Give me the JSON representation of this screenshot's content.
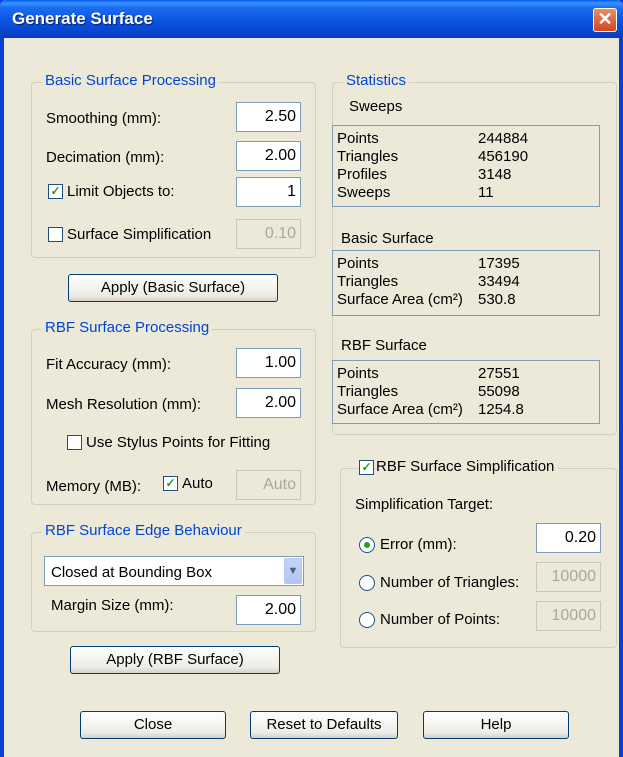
{
  "window": {
    "title": "Generate Surface",
    "close_glyph": "✕"
  },
  "basic": {
    "legend": "Basic Surface Processing",
    "smoothing_label": "Smoothing (mm):",
    "smoothing_value": "2.50",
    "decimation_label": "Decimation (mm):",
    "decimation_value": "2.00",
    "limit_label": "Limit Objects to:",
    "limit_checked": true,
    "limit_value": "1",
    "simplification_label": "Surface Simplification",
    "simplification_checked": false,
    "simplification_value": "0.10",
    "apply_label": "Apply (Basic Surface)"
  },
  "rbf": {
    "legend": "RBF Surface Processing",
    "fit_label": "Fit Accuracy (mm):",
    "fit_value": "1.00",
    "mesh_label": "Mesh Resolution (mm):",
    "mesh_value": "2.00",
    "stylus_label": "Use Stylus Points for Fitting",
    "stylus_checked": false,
    "memory_label": "Memory (MB):",
    "auto_label": "Auto",
    "auto_checked": true,
    "memory_value": "Auto"
  },
  "edge": {
    "legend": "RBF Surface Edge Behaviour",
    "selected": "Closed at Bounding Box",
    "margin_label": "Margin Size (mm):",
    "margin_value": "2.00",
    "apply_label": "Apply (RBF Surface)"
  },
  "statistics": {
    "legend": "Statistics",
    "sweeps_title": "Sweeps",
    "sweeps_rows": [
      {
        "label": "Points",
        "value": "244884"
      },
      {
        "label": "Triangles",
        "value": "456190"
      },
      {
        "label": "Profiles",
        "value": "3148"
      },
      {
        "label": "Sweeps",
        "value": "11"
      }
    ],
    "basic_title": "Basic Surface",
    "basic_rows": [
      {
        "label": "Points",
        "value": "17395"
      },
      {
        "label": "Triangles",
        "value": "33494"
      },
      {
        "label": "Surface Area (cm²)",
        "value": "530.8"
      }
    ],
    "rbf_title": "RBF Surface",
    "rbf_rows": [
      {
        "label": "Points",
        "value": "27551"
      },
      {
        "label": "Triangles",
        "value": "55098"
      },
      {
        "label": "Surface Area (cm²)",
        "value": "1254.8"
      }
    ]
  },
  "rbf_simplification": {
    "legend": "RBF Surface Simplification",
    "checked": true,
    "target_label": "Simplification Target:",
    "options": [
      {
        "label": "Error (mm):",
        "value": "0.20",
        "selected": true
      },
      {
        "label": "Number of Triangles:",
        "value": "10000",
        "selected": false
      },
      {
        "label": "Number of Points:",
        "value": "10000",
        "selected": false
      }
    ]
  },
  "footer": {
    "close_label": "Close",
    "reset_label": "Reset to Defaults",
    "help_label": "Help"
  },
  "glyphs": {
    "check": "✓",
    "dropdown": "▼"
  }
}
